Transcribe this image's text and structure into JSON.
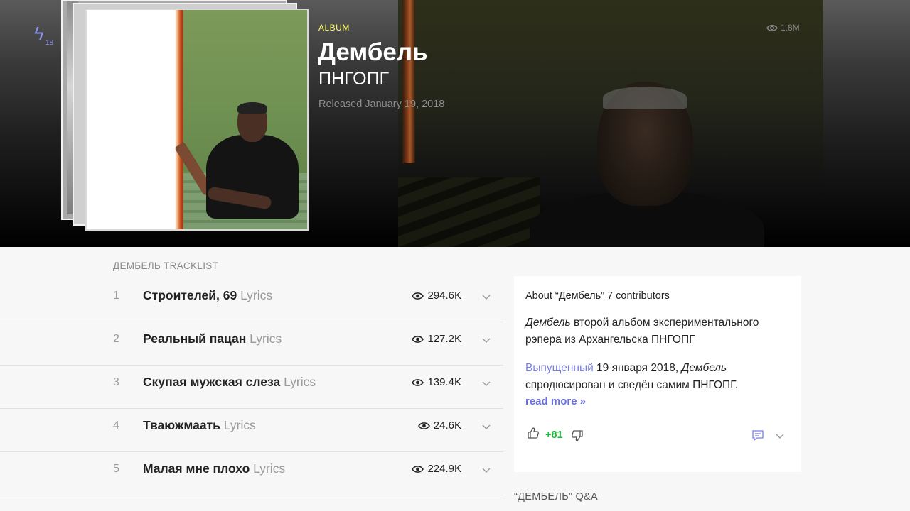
{
  "header": {
    "brand_count": "18",
    "album_label": "ALBUM",
    "album_title": "Дембель",
    "artist": "ПНГОПГ",
    "released": "Released January 19, 2018",
    "views": "1.8M"
  },
  "tracklist": {
    "heading": "ДЕМБЕЛЬ TRACKLIST",
    "tracks": [
      {
        "num": "1",
        "title": "Строителей, 69",
        "suffix": "Lyrics",
        "views": "294.6K"
      },
      {
        "num": "2",
        "title": "Реальный пацан",
        "suffix": "Lyrics",
        "views": "127.2K"
      },
      {
        "num": "3",
        "title": "Скупая мужская слеза",
        "suffix": "Lyrics",
        "views": "139.4K"
      },
      {
        "num": "4",
        "title": "Тваюжмаать",
        "suffix": "Lyrics",
        "views": "24.6K"
      },
      {
        "num": "5",
        "title": "Малая мне плохо",
        "suffix": "Lyrics",
        "views": "224.9K"
      }
    ]
  },
  "about": {
    "heading_prefix": "About “Дембель”",
    "contributors": "7 contributors",
    "p1_em": "Дембель",
    "p1_rest": " второй альбом экспериментального рэпера из Архангельска ПНГОПГ",
    "p2_link": "Выпущенный",
    "p2_mid": " 19 января 2018, ",
    "p2_em": "Дембель",
    "p2_rest": " спродюсирован и сведён самим ПНГОПГ.",
    "read_more": "read more »",
    "votes": "+81"
  },
  "qa": {
    "heading": "“ДЕМБЕЛЬ” Q&A"
  },
  "colors": {
    "accent_yellow": "#ffff64",
    "link_purple": "#7b7fe0",
    "vote_green": "#1bbf3a"
  }
}
